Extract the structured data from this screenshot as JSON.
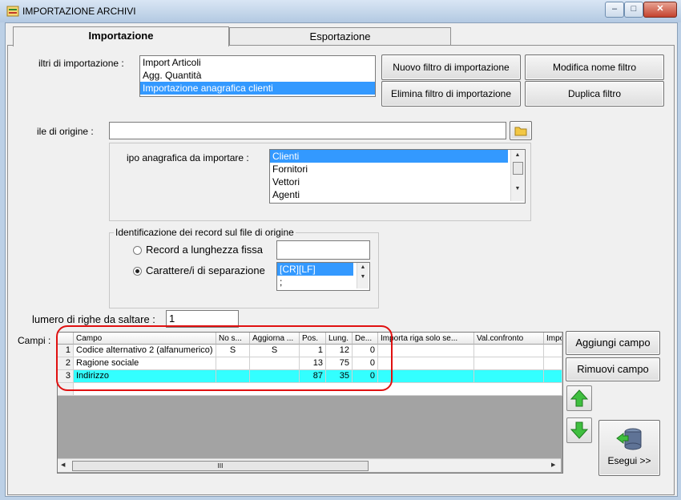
{
  "window": {
    "title": "IMPORTAZIONE ARCHIVI",
    "minimize": "–",
    "maximize": "□",
    "close": "✕"
  },
  "tabs": [
    {
      "label": "Importazione"
    },
    {
      "label": "Esportazione"
    }
  ],
  "filters": {
    "label": "iltri di importazione :",
    "items": [
      "Import Articoli",
      "Agg. Quantità",
      "Importazione anagrafica clienti"
    ],
    "selected_index": 2
  },
  "buttons": {
    "new_filter": "Nuovo filtro di importazione",
    "rename_filter": "Modifica nome filtro",
    "delete_filter": "Elimina filtro di importazione",
    "duplicate_filter": "Duplica filtro",
    "add_field": "Aggiungi campo",
    "remove_field": "Rimuovi campo",
    "execute": "Esegui >>"
  },
  "source_file": {
    "label": "ile di origine :",
    "value": ""
  },
  "registry_type": {
    "label": "ipo anagrafica da importare :",
    "items": [
      "Clienti",
      "Fornitori",
      "Vettori",
      "Agenti"
    ],
    "selected_index": 0
  },
  "record_id": {
    "group_label": "Identificazione dei record sul file di origine",
    "fixed_length_label": "Record a lunghezza fissa",
    "fixed_length_value": "",
    "separator_label": "Carattere/i di separazione",
    "separator_items": [
      "[CR][LF]",
      ";"
    ],
    "selected_option": "separator"
  },
  "skip_rows": {
    "label": "lumero di righe da saltare  :",
    "value": "1"
  },
  "fields": {
    "label": "Campi :",
    "columns": [
      "Campo",
      "No s...",
      "Aggiorna ...",
      "Pos.",
      "Lung.",
      "De...",
      "Importa riga solo se...",
      "Val.confronto",
      "Impo"
    ],
    "rows": [
      {
        "n": "1",
        "campo": "Codice alternativo 2 (alfanumerico)",
        "nos": "S",
        "aggiorna": "S",
        "pos": "1",
        "lung": "12",
        "de": "0",
        "importa": "",
        "val": "",
        "impo": ""
      },
      {
        "n": "2",
        "campo": "Ragione sociale",
        "nos": "",
        "aggiorna": "",
        "pos": "13",
        "lung": "75",
        "de": "0",
        "importa": "",
        "val": "",
        "impo": ""
      },
      {
        "n": "3",
        "campo": "Indirizzo",
        "nos": "",
        "aggiorna": "",
        "pos": "87",
        "lung": "35",
        "de": "0",
        "importa": "",
        "val": "",
        "impo": ""
      }
    ],
    "scroll_thumb": "III",
    "highlight_color": "#33ffff"
  },
  "colors": {
    "selection": "#3399ff",
    "annotation": "#e01010"
  }
}
